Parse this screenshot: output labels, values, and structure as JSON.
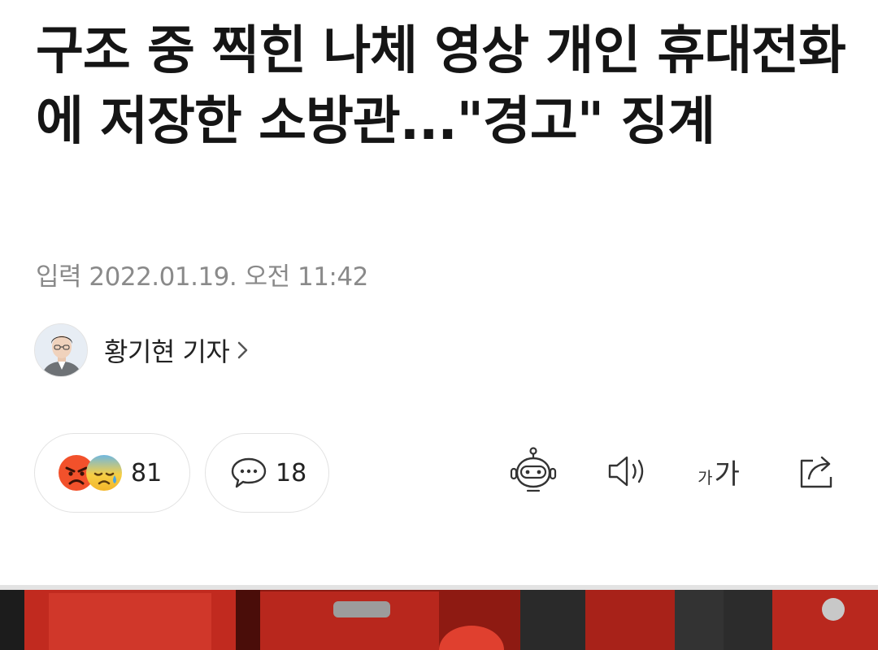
{
  "article": {
    "headline": "구조 중 찍힌 나체 영상 개인 휴대전화에 저장한 소방관...\"경고\" 징계",
    "published": "입력 2022.01.19. 오전 11:42"
  },
  "reporter": {
    "name": "황기현 기자",
    "avatar_icon": "reporter-avatar"
  },
  "reactions": {
    "icons": [
      "angry-face-icon",
      "sad-sweat-face-icon"
    ],
    "count": "81"
  },
  "comments": {
    "icon": "comment-bubble-icon",
    "count": "18"
  },
  "toolbar": {
    "font_small": "가",
    "font_big": "가",
    "items": [
      "robot-summary-icon",
      "speaker-icon",
      "font-size-icon",
      "share-icon"
    ]
  },
  "colors": {
    "headline": "#151515",
    "meta": "#8a8a8a",
    "photo_red": "#b3211a"
  }
}
